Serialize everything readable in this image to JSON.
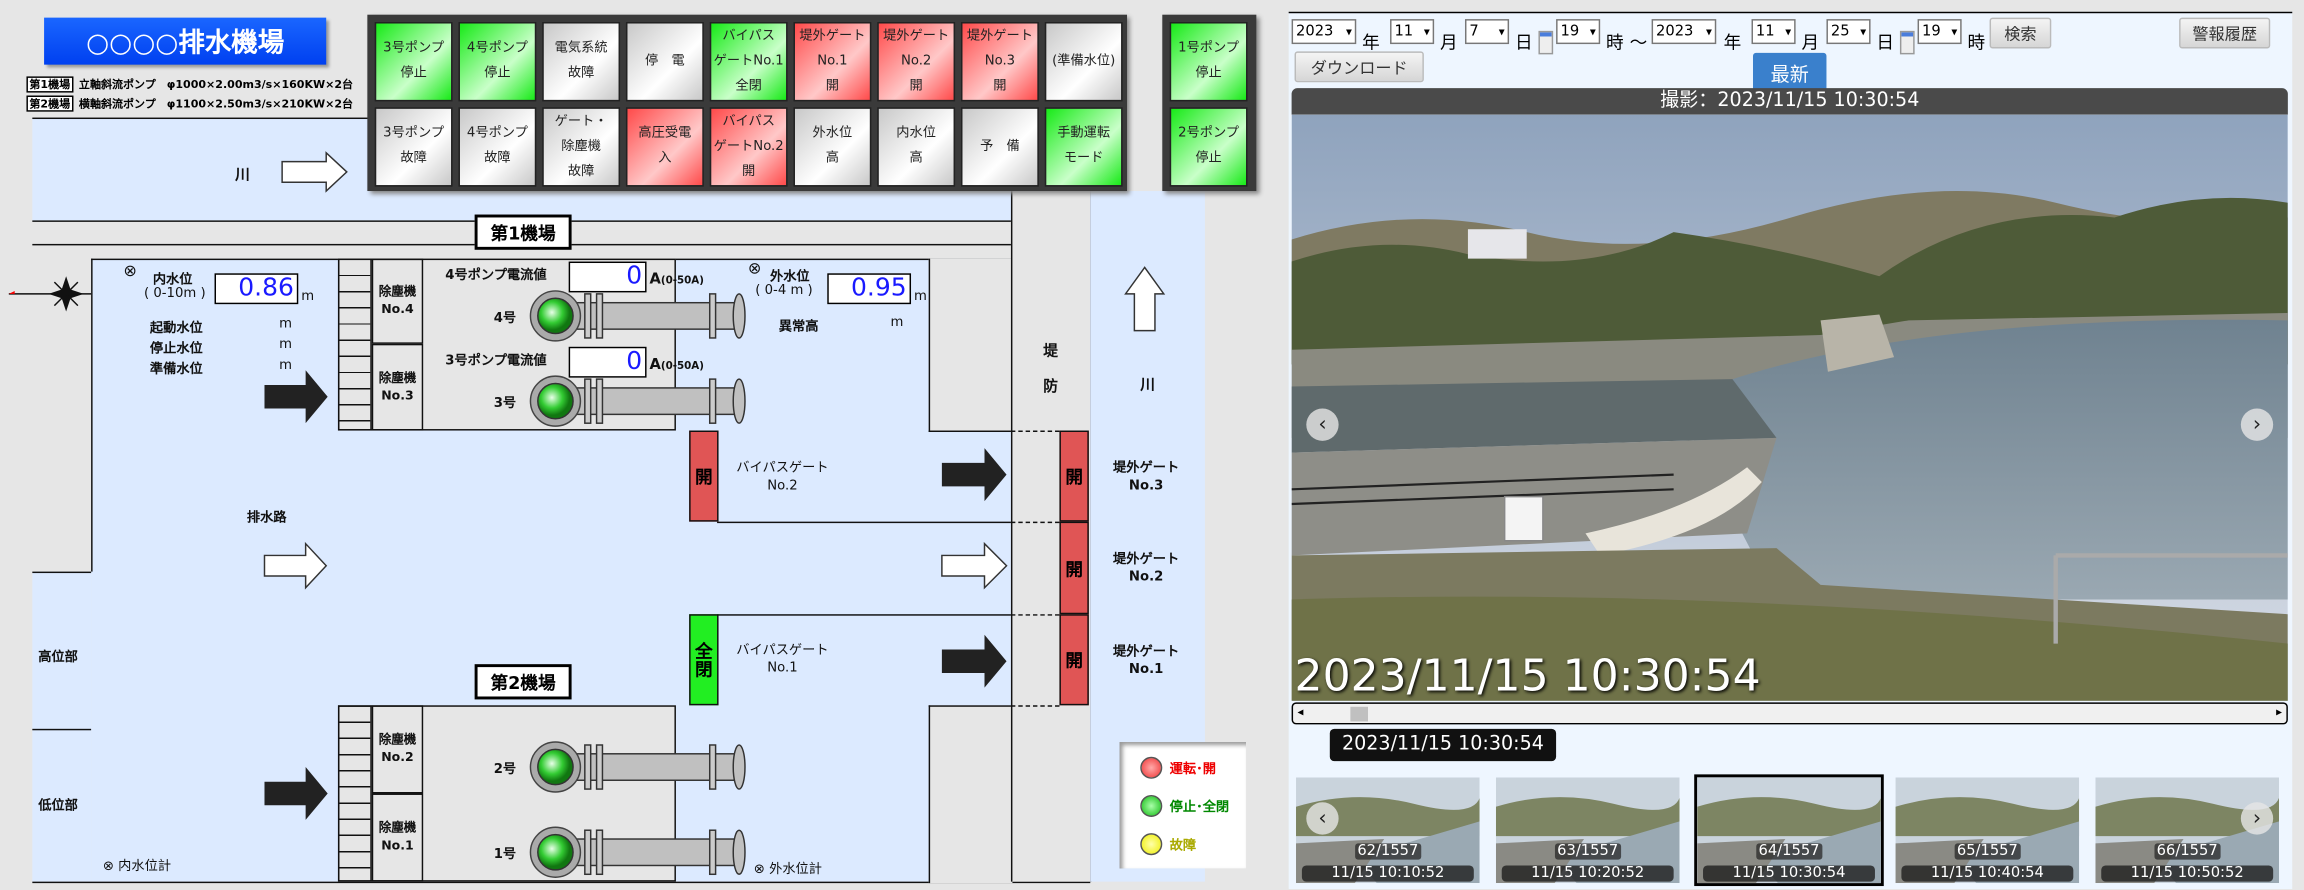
{
  "header": {
    "title": "○○○○排水機場",
    "spec1_tag": "第1機場",
    "spec1_text": "立軸斜流ポンプ　φ1000×2.00m3/s×160KW×2台",
    "spec2_tag": "第2機場",
    "spec2_text": "横軸斜流ポンプ　φ1100×2.50m3/s×210KW×2台"
  },
  "panel": {
    "cells": [
      {
        "lines": [
          "3号ポンプ",
          "停止"
        ],
        "state": "g"
      },
      {
        "lines": [
          "4号ポンプ",
          "停止"
        ],
        "state": "g"
      },
      {
        "lines": [
          "電気系統",
          "故障"
        ],
        "state": "n"
      },
      {
        "lines": [
          "停　電"
        ],
        "state": "n"
      },
      {
        "lines": [
          "バイパス",
          "ゲートNo.1",
          "全閉"
        ],
        "state": "g"
      },
      {
        "lines": [
          "堤外ゲート",
          "No.1",
          "開"
        ],
        "state": "r"
      },
      {
        "lines": [
          "堤外ゲート",
          "No.2",
          "開"
        ],
        "state": "r"
      },
      {
        "lines": [
          "堤外ゲート",
          "No.3",
          "開"
        ],
        "state": "r"
      },
      {
        "lines": [
          "(準備水位)"
        ],
        "state": "n"
      },
      {
        "lines": [
          "3号ポンプ",
          "故障"
        ],
        "state": "n"
      },
      {
        "lines": [
          "4号ポンプ",
          "故障"
        ],
        "state": "n"
      },
      {
        "lines": [
          "ゲート・",
          "除塵機",
          "故障"
        ],
        "state": "n"
      },
      {
        "lines": [
          "高圧受電",
          "入"
        ],
        "state": "r"
      },
      {
        "lines": [
          "バイパス",
          "ゲートNo.2",
          "開"
        ],
        "state": "r"
      },
      {
        "lines": [
          "外水位",
          "高"
        ],
        "state": "n"
      },
      {
        "lines": [
          "内水位",
          "高"
        ],
        "state": "n"
      },
      {
        "lines": [
          "予　備"
        ],
        "state": "n"
      },
      {
        "lines": [
          "手動運転",
          "モード"
        ],
        "state": "g"
      }
    ],
    "side_cells": [
      {
        "lines": [
          "1号ポンプ",
          "停止"
        ],
        "state": "g"
      },
      {
        "lines": [
          "2号ポンプ",
          "停止"
        ],
        "state": "g"
      }
    ]
  },
  "colors": {
    "g": "#17ea17",
    "r": "#ff4a4a",
    "n": "#c8c8c8"
  },
  "schematic": {
    "river": "川",
    "river2": "川",
    "station1": "第1機場",
    "station2": "第2機場",
    "inner_level": {
      "label": "内水位",
      "range": "( 0-10m )",
      "value": "0.86",
      "unit": "m"
    },
    "outer_level": {
      "label": "外水位",
      "range": "( 0-4 m )",
      "value": "0.95",
      "unit": "m"
    },
    "start_level": "起動水位",
    "stop_level": "停止水位",
    "ready_level": "準備水位",
    "m": "m",
    "abnormal": "異常高",
    "pump4_current": {
      "label": "4号ポンプ電流値",
      "value": "0",
      "unit": "A",
      "range": "(0-50A)"
    },
    "pump3_current": {
      "label": "3号ポンプ電流値",
      "value": "0",
      "unit": "A",
      "range": "(0-50A)"
    },
    "pumps": {
      "p4": "4号",
      "p3": "3号",
      "p2": "2号",
      "p1": "1号"
    },
    "screens": {
      "s4": [
        "除塵機",
        "No.4"
      ],
      "s3": [
        "除塵機",
        "No.3"
      ],
      "s2": [
        "除塵機",
        "No.2"
      ],
      "s1": [
        "除塵機",
        "No.1"
      ]
    },
    "drain": "排水路",
    "high": "高位部",
    "low": "低位部",
    "inner_gauge": "内水位計",
    "outer_gauge": "外水位計",
    "bypass2": {
      "name": "バイパスゲート",
      "no": "No.2",
      "state": "開"
    },
    "bypass1": {
      "name": "バイパスゲート",
      "no": "No.1",
      "state": "全閉"
    },
    "levee": [
      "堤",
      "防"
    ],
    "gate3": {
      "name": "堤外ゲート",
      "no": "No.3",
      "state": "開"
    },
    "gate2": {
      "name": "堤外ゲート",
      "no": "No.2",
      "state": "開"
    },
    "gate1": {
      "name": "堤外ゲート",
      "no": "No.1",
      "state": "開"
    }
  },
  "legend": {
    "run": "運転･開",
    "stop": "停止･全閉",
    "fault": "故障"
  },
  "camera": {
    "from": {
      "year": "2023",
      "month": "11",
      "day": "7",
      "hour": "19"
    },
    "to": {
      "year": "2023",
      "month": "11",
      "day": "25",
      "hour": "19"
    },
    "u_year": "年",
    "u_month": "月",
    "u_day": "日",
    "u_hour": "時",
    "tilde": "～",
    "search": "検索",
    "alarm_history": "警報履歴",
    "download": "ダウンロード",
    "latest": "最新",
    "caption": "撮影：2023/11/15 10:30:54",
    "overlay": "2023/11/15 10:30:54",
    "tooltip": "2023/11/15 10:30:54",
    "thumbs": [
      {
        "count": "62/1557",
        "time": "11/15 10:10:52"
      },
      {
        "count": "63/1557",
        "time": "11/15 10:20:52"
      },
      {
        "count": "64/1557",
        "time": "11/15 10:30:54",
        "selected": true
      },
      {
        "count": "65/1557",
        "time": "11/15 10:40:54"
      },
      {
        "count": "66/1557",
        "time": "11/15 10:50:52"
      }
    ]
  }
}
